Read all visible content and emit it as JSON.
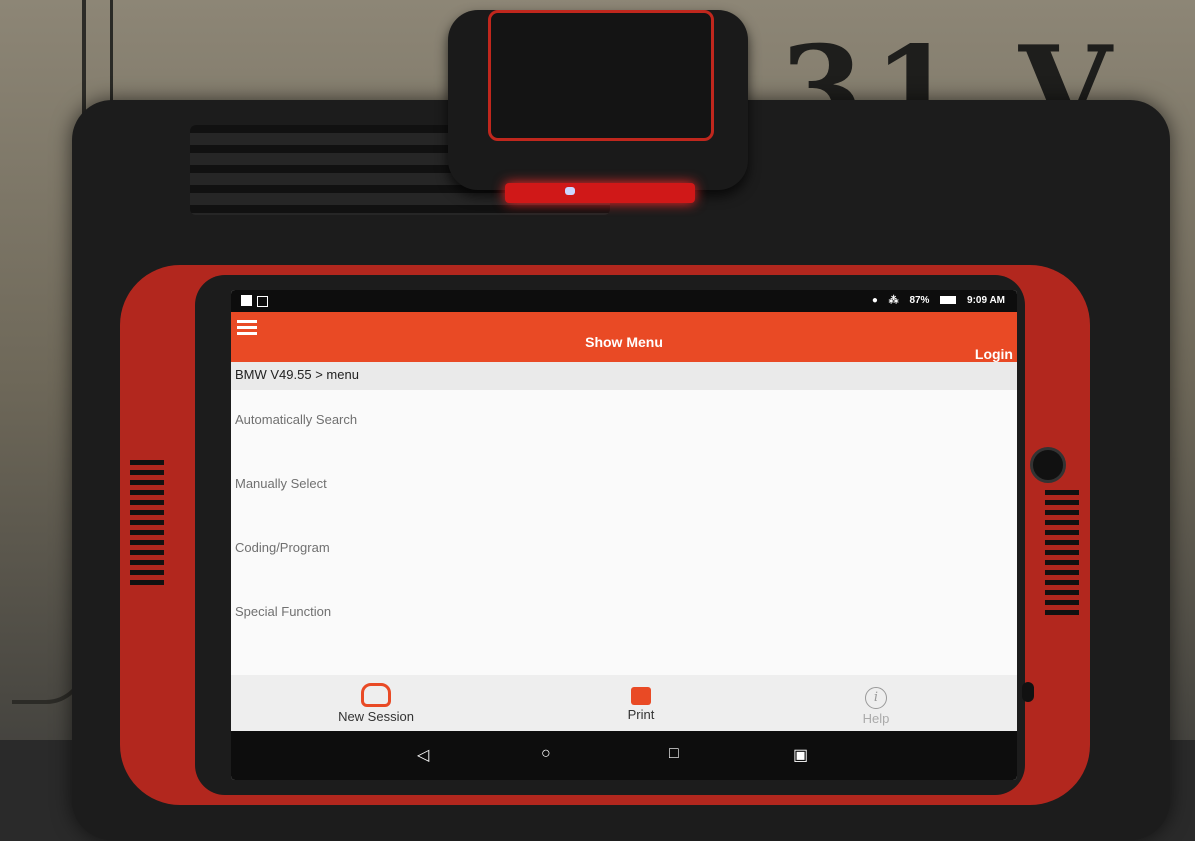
{
  "background": {
    "box_print": "31 V"
  },
  "status_bar": {
    "battery": "87%",
    "time": "9:09 AM"
  },
  "app_bar": {
    "title": "Show Menu",
    "login_label": "Login",
    "accent_color": "#e94a25"
  },
  "breadcrumb": "BMW V49.55 > menu",
  "menu_items": [
    {
      "label": "Automatically Search"
    },
    {
      "label": "Manually Select"
    },
    {
      "label": "Coding/Program"
    },
    {
      "label": "Special Function"
    }
  ],
  "bottom_bar": {
    "new_session_label": "New Session",
    "new_session_icon": "car-icon",
    "print_label": "Print",
    "print_icon": "printer-icon",
    "help_label": "Help",
    "help_icon": "info-icon"
  },
  "nav_bar": {
    "back_icon": "back-icon",
    "home_icon": "home-icon",
    "recent_icon": "recent-apps-icon",
    "screenshot_icon": "screenshot-icon"
  }
}
